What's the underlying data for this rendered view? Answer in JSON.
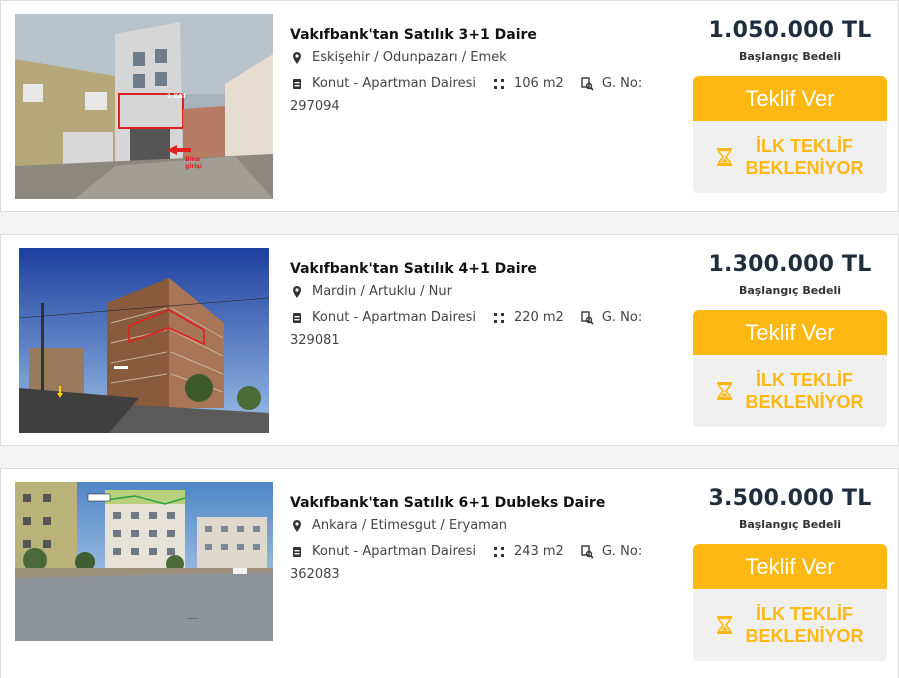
{
  "listings": [
    {
      "title": "Vakıfbank'tan Satılık 3+1 Daire",
      "location": "Eskişehir / Odunpazarı / Emek",
      "type": "Konut - Apartman Dairesi",
      "area": "106 m2",
      "gno_label": "G. No:",
      "gno": "297094",
      "price": "1.050.000 TL",
      "price_label": "Başlangıç Bedeli",
      "offer_button": "Teklif Ver",
      "status": "İLK TEKLİF\nBEKLENİYOR",
      "photo_labels": [
        "1.KAT",
        "Bina\ngirişi"
      ]
    },
    {
      "title": "Vakıfbank'tan Satılık 4+1 Daire",
      "location": "Mardin / Artuklu / Nur",
      "type": "Konut - Apartman Dairesi",
      "area": "220 m2",
      "gno_label": "G. No:",
      "gno": "329081",
      "price": "1.300.000 TL",
      "price_label": "Başlangıç Bedeli",
      "offer_button": "Teklif Ver",
      "status": "İLK TEKLİF\nBEKLENİYOR",
      "photo_labels": []
    },
    {
      "title": "Vakıfbank'tan Satılık 6+1 Dubleks Daire",
      "location": "Ankara / Etimesgut / Eryaman",
      "type": "Konut - Apartman Dairesi",
      "area": "243 m2",
      "gno_label": "G. No:",
      "gno": "362083",
      "price": "3.500.000 TL",
      "price_label": "Başlangıç Bedeli",
      "offer_button": "Teklif Ver",
      "status": "İLK TEKLİF\nBEKLENİYOR",
      "photo_labels": []
    }
  ],
  "colors": {
    "accent": "#fdb813",
    "price_text": "#1f2d3d",
    "status_bg": "#f0f0f0"
  },
  "icons": {
    "location": "map-pin-icon",
    "type": "building-icon",
    "area": "area-dots-icon",
    "gno": "document-search-icon",
    "status": "hourglass-icon"
  }
}
